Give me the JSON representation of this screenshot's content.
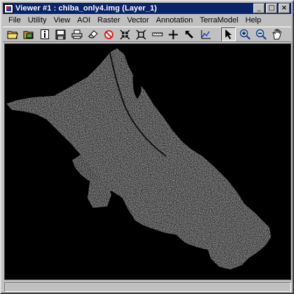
{
  "window": {
    "title": "Viewer #1 : chiba_only4.img (Layer_1)",
    "minimize_glyph": "_",
    "maximize_glyph": "□",
    "close_glyph": "×"
  },
  "menu": [
    {
      "label": "File"
    },
    {
      "label": "Utility"
    },
    {
      "label": "View"
    },
    {
      "label": "AOI"
    },
    {
      "label": "Raster"
    },
    {
      "label": "Vector"
    },
    {
      "label": "Annotation"
    },
    {
      "label": "TerraModel"
    },
    {
      "label": "Help"
    }
  ],
  "toolbar": {
    "tools": [
      {
        "icon": "open-folder-icon"
      },
      {
        "icon": "open-layer-icon"
      },
      {
        "icon": "info-icon"
      },
      {
        "icon": "save-icon"
      },
      {
        "icon": "print-icon"
      },
      {
        "icon": "eraser-icon"
      },
      {
        "icon": "no-symbol-icon"
      },
      {
        "icon": "zoom-in-arrows-icon"
      },
      {
        "icon": "zoom-out-arrows-icon"
      },
      {
        "icon": "measure-icon"
      },
      {
        "icon": "crosshair-icon"
      },
      {
        "icon": "roam-icon"
      },
      {
        "icon": "profile-icon"
      },
      {
        "icon": "select-arrow-icon"
      },
      {
        "icon": "zoom-in-icon"
      },
      {
        "icon": "zoom-out-icon"
      },
      {
        "icon": "pan-hand-icon"
      }
    ],
    "active_tool": "select-arrow-icon"
  },
  "viewer": {
    "image_name": "chiba_only4.img",
    "layer": "Layer_1",
    "background": "#000000"
  },
  "status": {
    "text": ""
  },
  "colors": {
    "titlebar": "#0a246a",
    "chrome": "#c0c0c0",
    "map_land": "#3a3a3a"
  }
}
